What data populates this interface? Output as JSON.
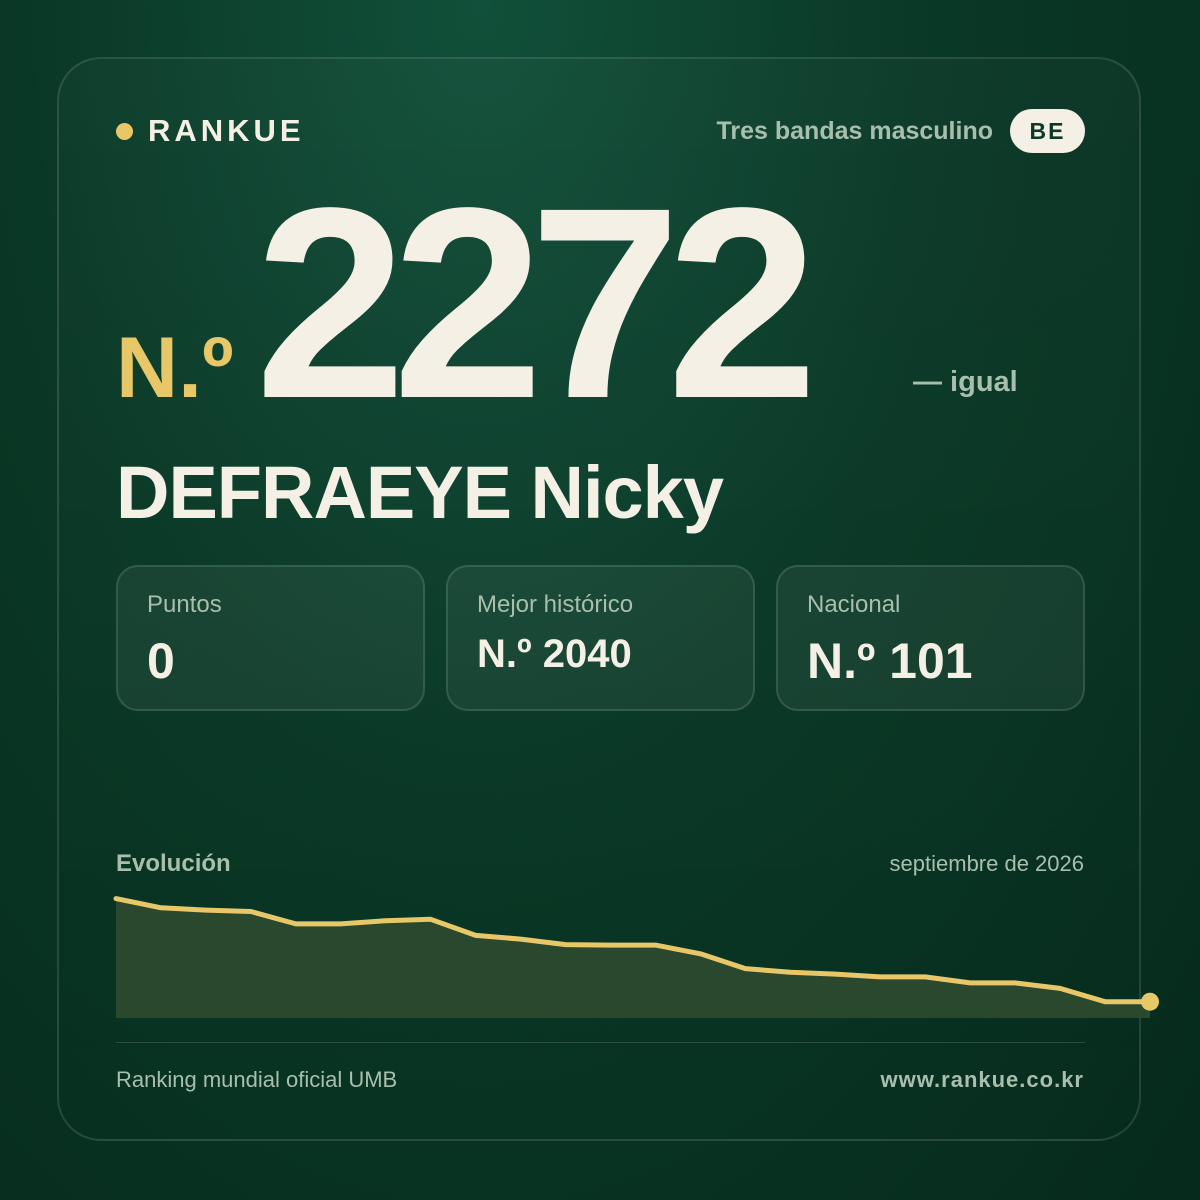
{
  "brand": {
    "name": "RANKUE",
    "accent_color": "#e8c769"
  },
  "header": {
    "category": "Tres bandas masculino",
    "country_badge": "BE"
  },
  "rank": {
    "prefix": "N.º",
    "value": "2272",
    "change": "— igual"
  },
  "player": {
    "name": "DEFRAEYE Nicky"
  },
  "stats": [
    {
      "label": "Puntos",
      "value": "0"
    },
    {
      "label": "Mejor histórico",
      "value": "N.º 2040"
    },
    {
      "label": "Nacional",
      "value": "N.º 101"
    }
  ],
  "evolution": {
    "label": "Evolución",
    "date": "septiembre de 2026"
  },
  "chart_data": {
    "type": "area",
    "line_color": "#e8c769",
    "fill_color": "#2b4a2f",
    "y_inverted": true,
    "ylim": [
      2020,
      2285
    ],
    "values": [
      2030,
      2050,
      2055,
      2058,
      2085,
      2085,
      2078,
      2075,
      2110,
      2118,
      2130,
      2131,
      2131,
      2150,
      2182,
      2190,
      2194,
      2200,
      2200,
      2213,
      2213,
      2225,
      2254,
      2254
    ]
  },
  "footer": {
    "source": "Ranking mundial oficial UMB",
    "website": "www.rankue.co.kr"
  }
}
